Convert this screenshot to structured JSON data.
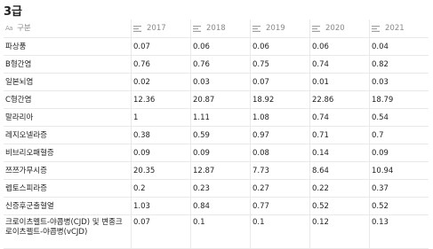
{
  "title": "3급",
  "header": {
    "first_col_icon": "Aa",
    "first_col": "구분",
    "years": [
      "2017",
      "2018",
      "2019",
      "2020",
      "2021"
    ]
  },
  "rows": [
    {
      "name": "파상풍",
      "values": [
        "0.07",
        "0.06",
        "0.06",
        "0.06",
        "0.04"
      ]
    },
    {
      "name": "B형간염",
      "values": [
        "0.76",
        "0.76",
        "0.75",
        "0.74",
        "0.82"
      ]
    },
    {
      "name": "일본뇌염",
      "values": [
        "0.02",
        "0.03",
        "0.07",
        "0.01",
        "0.03"
      ]
    },
    {
      "name": "C형간염",
      "values": [
        "12.36",
        "20.87",
        "18.92",
        "22.86",
        "18.79"
      ]
    },
    {
      "name": "말라리아",
      "values": [
        "1",
        "1.11",
        "1.08",
        "0.74",
        "0.54"
      ]
    },
    {
      "name": "레지오넬라증",
      "values": [
        "0.38",
        "0.59",
        "0.97",
        "0.71",
        "0.7"
      ]
    },
    {
      "name": "비브리오패혈증",
      "values": [
        "0.09",
        "0.09",
        "0.08",
        "0.14",
        "0.09"
      ]
    },
    {
      "name": "쯔쯔가무시증",
      "values": [
        "20.35",
        "12.87",
        "7.73",
        "8.64",
        "10.94"
      ]
    },
    {
      "name": "렙토스피라증",
      "values": [
        "0.2",
        "0.23",
        "0.27",
        "0.22",
        "0.37"
      ]
    },
    {
      "name": "신증후군출혈열",
      "values": [
        "1.03",
        "0.84",
        "0.77",
        "0.52",
        "0.52"
      ]
    },
    {
      "name": "크로이츠펠트-야콥병(CJD) 및 변종크로이츠펠트-야콥병(vCJD)",
      "values": [
        "0.07",
        "0.1",
        "0.1",
        "0.12",
        "0.13"
      ]
    }
  ]
}
